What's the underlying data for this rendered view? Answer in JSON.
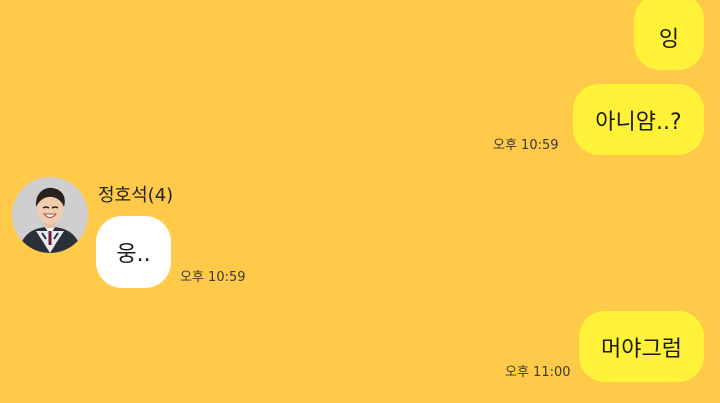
{
  "messages": {
    "out1": {
      "text": "잉"
    },
    "out2": {
      "text": "아니얌..?",
      "time": "오후 10:59"
    },
    "in1": {
      "sender": "정호석(4)",
      "text": "웅..",
      "time": "오후 10:59"
    },
    "out3": {
      "text": "머야그럼",
      "time": "오후 11:00"
    }
  },
  "colors": {
    "background": "#FFC94A",
    "outgoing_bubble": "#FFF238",
    "incoming_bubble": "#FFFFFF"
  }
}
